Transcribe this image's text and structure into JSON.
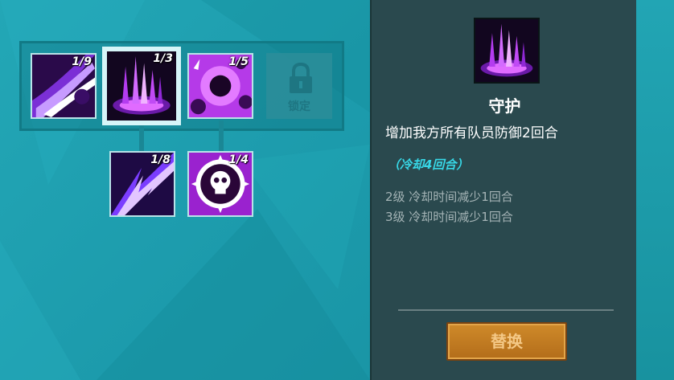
{
  "skill_tree": {
    "row1": [
      {
        "level": "1/9",
        "icon": "slash-icon"
      },
      {
        "level": "1/3",
        "icon": "guard-pillar-icon"
      },
      {
        "level": "1/5",
        "icon": "orb-burst-icon"
      },
      {
        "level": "",
        "icon": "lock-icon",
        "locked_label": "锁定"
      }
    ],
    "row2": [
      {
        "level": "1/8",
        "icon": "lightning-slash-icon"
      },
      {
        "level": "1/4",
        "icon": "skull-icon"
      }
    ]
  },
  "detail": {
    "name": "守护",
    "description": "增加我方所有队员防御2回合",
    "cooldown": "（冷却4回合）",
    "upgrades": [
      "2级 冷却时间减少1回合",
      "3级 冷却时间减少1回合"
    ],
    "button_label": "替换",
    "icon": "guard-pillar-icon"
  },
  "colors": {
    "background": "#1d9cad",
    "panel": "#2a494e",
    "cooldown_text": "#37d7e6",
    "button": "#c27b22"
  }
}
